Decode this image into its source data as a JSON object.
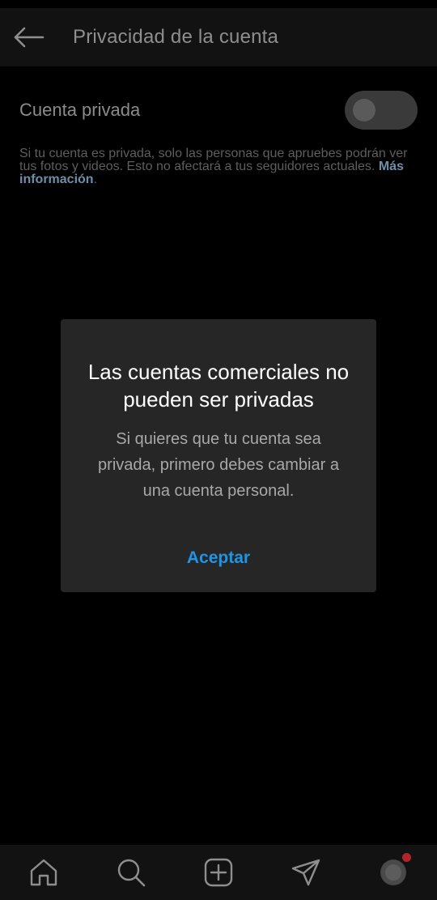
{
  "header": {
    "title": "Privacidad de la cuenta",
    "back_icon": "arrow-left-icon"
  },
  "private_account": {
    "label": "Cuenta privada",
    "toggle_on": false,
    "description": "Si tu cuenta es privada, solo las personas que apruebes podrán ver tus fotos y videos. Esto no afectará a tus seguidores actuales.",
    "more_link": "Más información",
    "trailing": "."
  },
  "dialog": {
    "title": "Las cuentas comerciales no pueden ser privadas",
    "body": "Si quieres que tu cuenta sea privada, primero debes cambiar a una cuenta personal.",
    "accept_label": "Aceptar"
  },
  "bottom_nav": {
    "items": [
      "home-icon",
      "search-icon",
      "new-post-icon",
      "direct-message-icon",
      "profile-avatar"
    ],
    "has_notification": true
  },
  "colors": {
    "background": "#000000",
    "header": "#121212",
    "dialog": "#262626",
    "accent": "#1f95e6",
    "notification": "#b1242c"
  }
}
